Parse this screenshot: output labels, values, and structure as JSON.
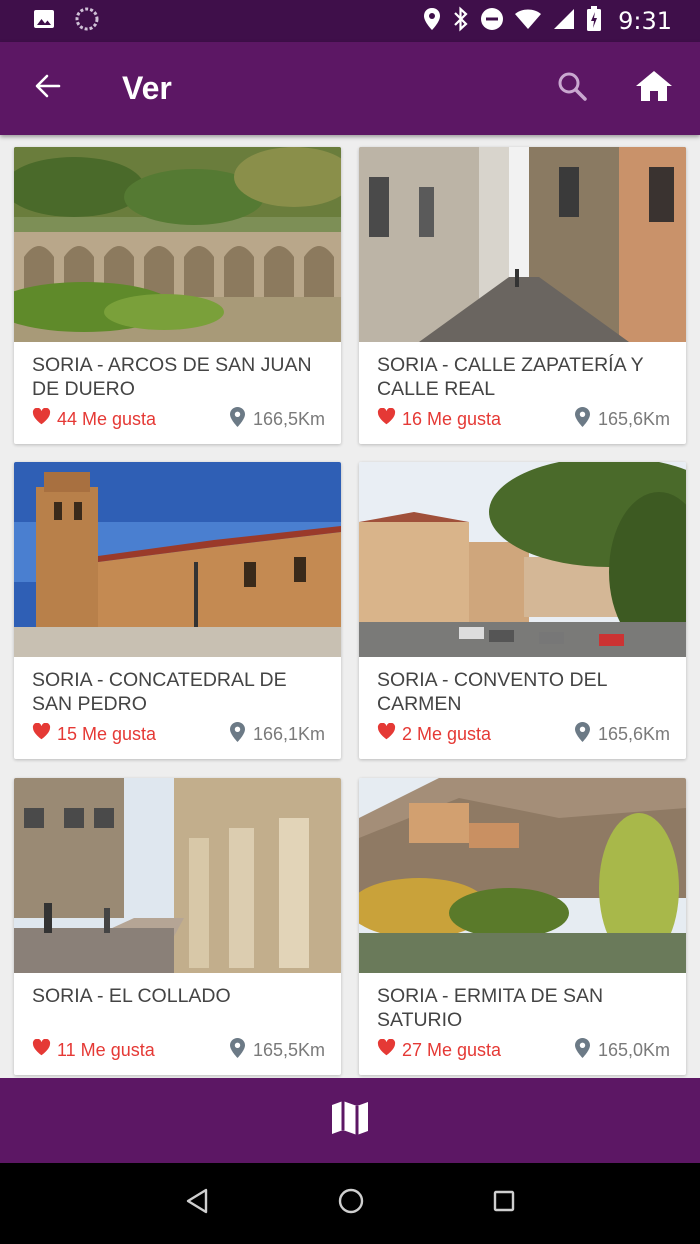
{
  "status_bar": {
    "time": "9:31",
    "left_icons": [
      "image-icon",
      "loading-icon"
    ],
    "right_icons": [
      "location-icon",
      "bluetooth-icon",
      "do-not-disturb-icon",
      "wifi-icon",
      "signal-icon",
      "battery-icon"
    ]
  },
  "app_bar": {
    "title": "Ver",
    "back_icon": "arrow-back-icon",
    "search_icon": "search-icon",
    "home_icon": "home-icon"
  },
  "places": [
    {
      "name": "SORIA - ARCOS DE SAN JUAN DE DUERO",
      "likes": "44 Me gusta",
      "distance": "166,5Km"
    },
    {
      "name": "SORIA - CALLE ZAPATERÍA Y CALLE REAL",
      "likes": "16 Me gusta",
      "distance": "165,6Km"
    },
    {
      "name": "SORIA - CONCATEDRAL DE SAN PEDRO",
      "likes": "15 Me gusta",
      "distance": "166,1Km"
    },
    {
      "name": "SORIA - CONVENTO DEL CARMEN",
      "likes": "2 Me gusta",
      "distance": "165,6Km"
    },
    {
      "name": "SORIA - EL COLLADO",
      "likes": "11 Me gusta",
      "distance": "165,5Km"
    },
    {
      "name": "SORIA - ERMITA DE SAN SATURIO",
      "likes": "27 Me gusta",
      "distance": "165,0Km"
    }
  ],
  "bottom_bar": {
    "icon": "map-icon"
  },
  "nav_bar": {
    "icons": [
      "back-triangle-icon",
      "home-circle-icon",
      "recents-square-icon"
    ]
  },
  "colors": {
    "primary": "#5c1764",
    "status_bar": "#3f0f4a",
    "like_red": "#e53935",
    "distance_gray": "#7a7a7a",
    "background": "#eeeeee"
  }
}
